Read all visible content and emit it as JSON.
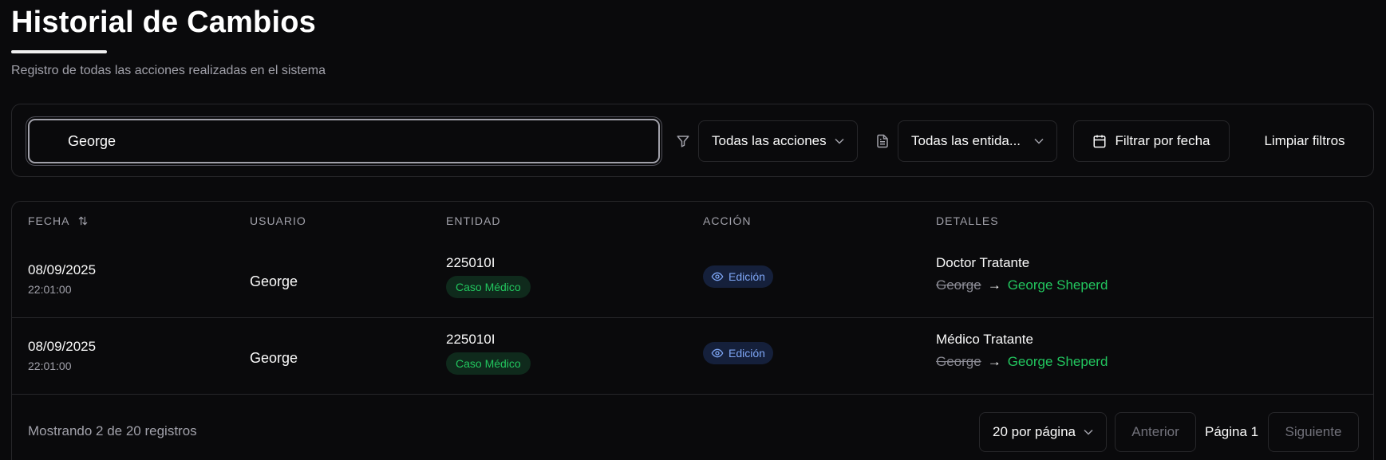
{
  "header": {
    "title": "Historial de Cambios",
    "subtitle": "Registro de todas las acciones realizadas en el sistema"
  },
  "filters": {
    "search_value": "George",
    "actions_select": "Todas las acciones",
    "entities_select": "Todas las entida...",
    "date_button": "Filtrar por fecha",
    "clear_button": "Limpiar filtros"
  },
  "table": {
    "columns": [
      "FECHA",
      "USUARIO",
      "ENTIDAD",
      "ACCIÓN",
      "DETALLES"
    ],
    "rows": [
      {
        "date": "08/09/2025",
        "time": "22:01:00",
        "user": "George",
        "entity_id": "225010I",
        "entity_type": "Caso Médico",
        "action": "Edición",
        "field": "Doctor Tratante",
        "old_value": "George",
        "arrow": "→",
        "new_value": "George Sheperd"
      },
      {
        "date": "08/09/2025",
        "time": "22:01:00",
        "user": "George",
        "entity_id": "225010I",
        "entity_type": "Caso Médico",
        "action": "Edición",
        "field": "Médico Tratante",
        "old_value": "George",
        "arrow": "→",
        "new_value": "George Sheperd"
      }
    ]
  },
  "footer": {
    "showing": "Mostrando 2 de 20 registros",
    "per_page": "20 por página",
    "prev": "Anterior",
    "page": "Página 1",
    "next": "Siguiente"
  },
  "colors": {
    "background": "#0a0a0c",
    "border": "#27272a",
    "success": "#22c55e",
    "info": "#7ea6f5"
  },
  "icons": [
    "sort-icon",
    "filter-icon",
    "document-icon",
    "calendar-icon",
    "chevron-down-icon",
    "eye-icon"
  ]
}
